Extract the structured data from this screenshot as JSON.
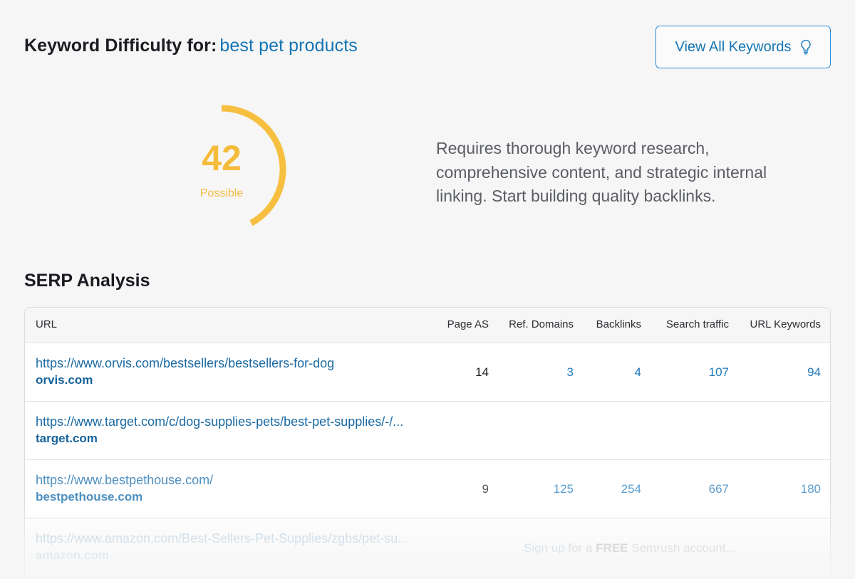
{
  "header": {
    "title_prefix": "Keyword Difficulty for:",
    "keyword": "best pet products",
    "view_all_label": "View All Keywords"
  },
  "difficulty": {
    "score": "42",
    "score_fraction": 0.42,
    "level": "Possible",
    "color": "#f7bf3f",
    "description": "Requires thorough keyword research, comprehensive content, and strategic internal linking. Start building quality backlinks."
  },
  "serp": {
    "title": "SERP Analysis",
    "columns": {
      "url": "URL",
      "page_as": "Page AS",
      "ref_domains": "Ref. Domains",
      "backlinks": "Backlinks",
      "search_traffic": "Search traffic",
      "url_keywords": "URL Keywords"
    },
    "rows": [
      {
        "url": "https://www.orvis.com/bestsellers/bestsellers-for-dog",
        "domain": "orvis.com",
        "page_as": "14",
        "ref_domains": "3",
        "backlinks": "4",
        "search_traffic": "107",
        "url_keywords": "94"
      },
      {
        "url": "https://www.target.com/c/dog-supplies-pets/best-pet-supplies/-/...",
        "domain": "target.com",
        "page_as": "",
        "ref_domains": "",
        "backlinks": "",
        "search_traffic": "",
        "url_keywords": ""
      },
      {
        "url": "https://www.bestpethouse.com/",
        "domain": "bestpethouse.com",
        "page_as": "9",
        "ref_domains": "125",
        "backlinks": "254",
        "search_traffic": "667",
        "url_keywords": "180"
      },
      {
        "url": "https://www.amazon.com/Best-Sellers-Pet-Supplies/zgbs/pet-su...",
        "domain": "amazon.com"
      }
    ],
    "signup": {
      "link_text": "Sign up",
      "middle": "for a",
      "bold": "FREE",
      "rest": "Semrush account..."
    }
  },
  "colors": {
    "accent_blue": "#1475b4",
    "gauge_yellow": "#f7bf3f"
  },
  "icons": {
    "view_all": "lightbulb-icon"
  }
}
